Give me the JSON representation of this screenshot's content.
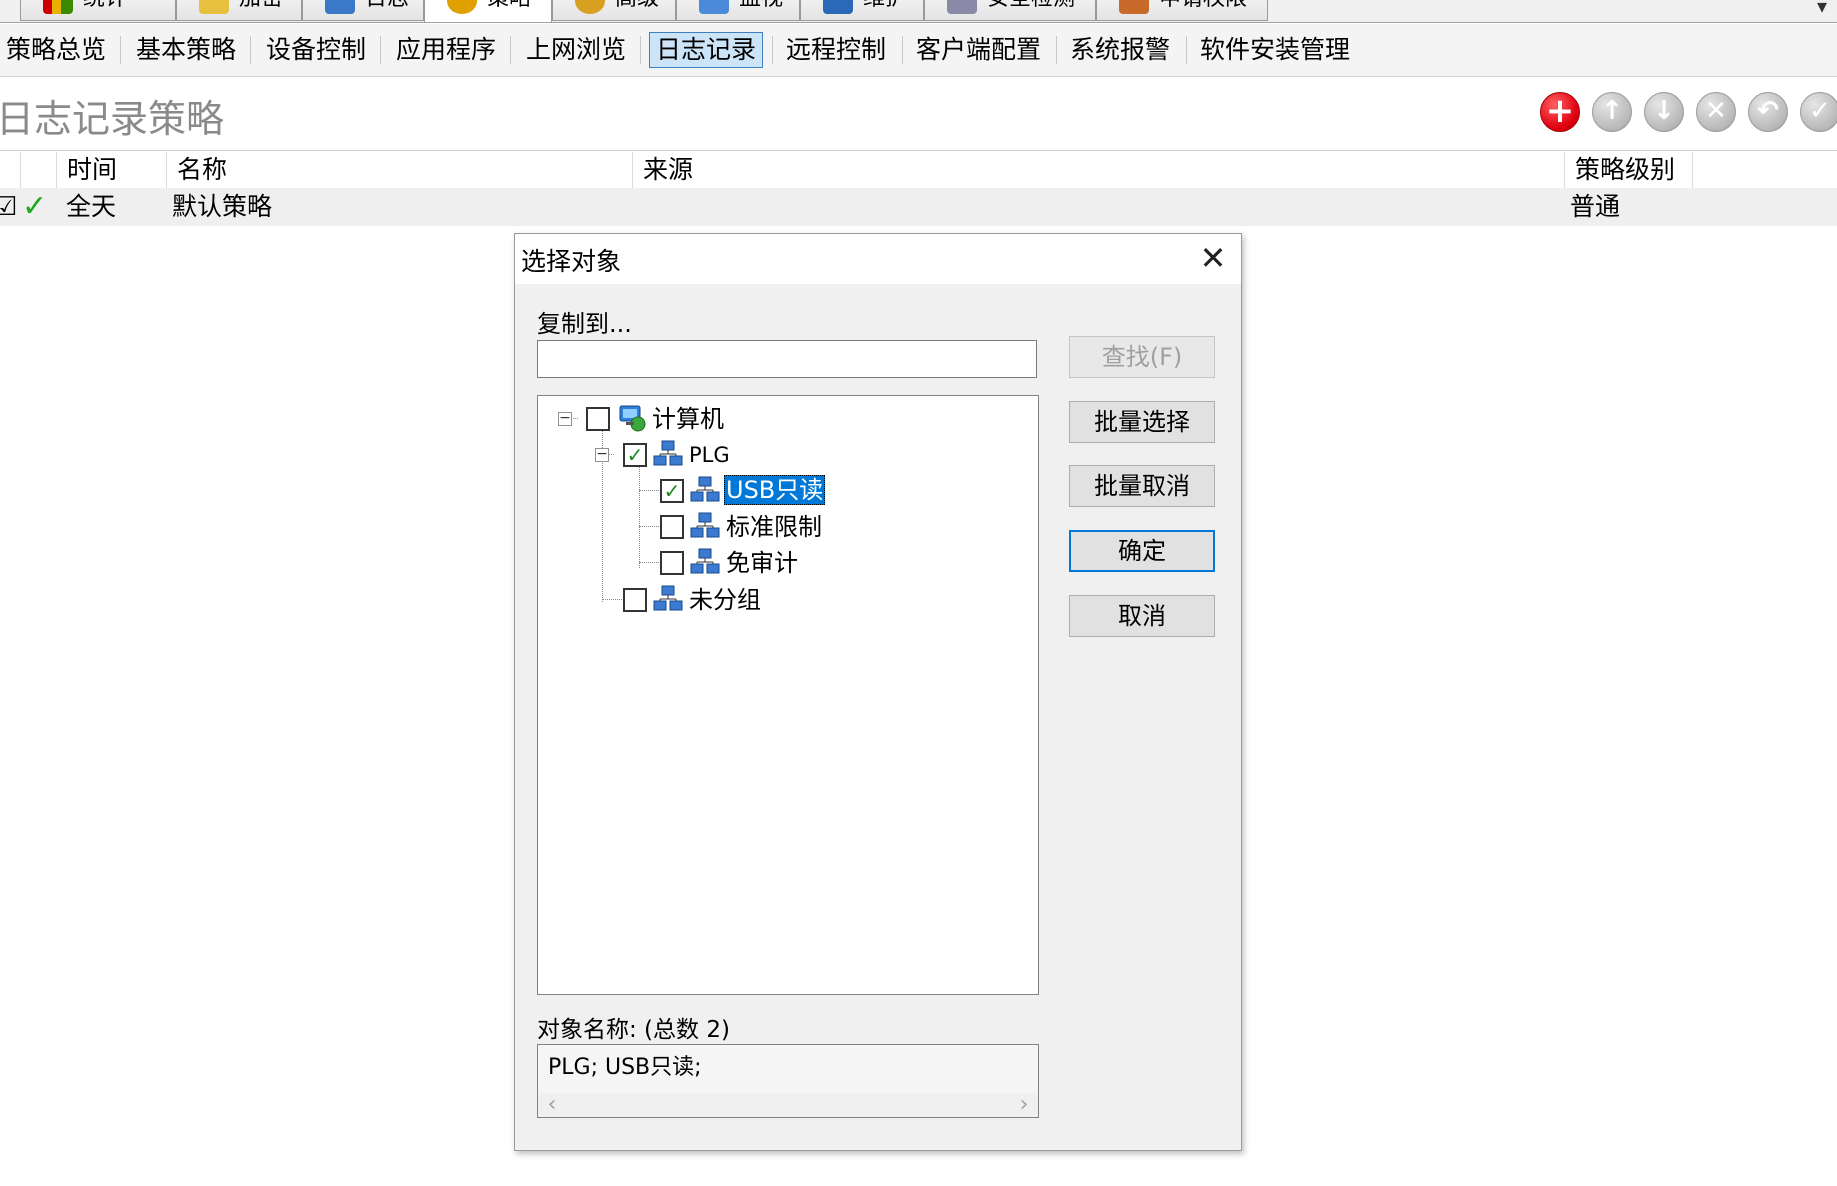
{
  "top_tabs": [
    {
      "label": "统计",
      "icon": "bar-chart-icon",
      "active": false
    },
    {
      "label": "加密",
      "icon": "lock-folder-icon",
      "active": false
    },
    {
      "label": "日志",
      "icon": "book-icon",
      "active": false
    },
    {
      "label": "策略",
      "icon": "gear-icon",
      "active": true
    },
    {
      "label": "高级",
      "icon": "gears-icon",
      "active": false
    },
    {
      "label": "监视",
      "icon": "monitor-icon",
      "active": false
    },
    {
      "label": "维护",
      "icon": "wrench-icon",
      "active": false
    },
    {
      "label": "安全检测",
      "icon": "shield-scan-icon",
      "active": false
    },
    {
      "label": "申请权限",
      "icon": "form-pencil-icon",
      "active": false
    }
  ],
  "subnav": [
    {
      "label": "策略总览"
    },
    {
      "label": "基本策略"
    },
    {
      "label": "设备控制"
    },
    {
      "label": "应用程序"
    },
    {
      "label": "上网浏览"
    },
    {
      "label": "日志记录"
    },
    {
      "label": "远程控制"
    },
    {
      "label": "客户端配置"
    },
    {
      "label": "系统报警"
    },
    {
      "label": "软件安装管理"
    }
  ],
  "subnav_active": "日志记录",
  "page": {
    "title": "日志记录策略"
  },
  "toolbar": {
    "buttons": [
      {
        "name": "add-button",
        "icon": "plus-icon",
        "enabled": true
      },
      {
        "name": "move-up-button",
        "icon": "arrow-up-icon",
        "enabled": false
      },
      {
        "name": "move-down-button",
        "icon": "arrow-down-icon",
        "enabled": false
      },
      {
        "name": "delete-button",
        "icon": "x-icon",
        "enabled": false
      },
      {
        "name": "undo-button",
        "icon": "undo-icon",
        "enabled": false
      },
      {
        "name": "apply-button",
        "icon": "checkmark-icon",
        "enabled": false
      }
    ]
  },
  "table": {
    "columns": [
      "时间",
      "名称",
      "来源",
      "策略级别"
    ],
    "rows": [
      {
        "checked": true,
        "enabled": true,
        "time": "全天",
        "name": "默认策略",
        "source": "",
        "level": "普通"
      }
    ]
  },
  "dialog": {
    "title": "选择对象",
    "copy_to_label": "复制到...",
    "copy_to_value": "",
    "buttons": {
      "find": "查找(F)",
      "batch_select": "批量选择",
      "batch_cancel": "批量取消",
      "ok": "确定",
      "cancel": "取消"
    },
    "tree": {
      "root": {
        "label": "计算机",
        "checked": false,
        "expanded": true
      },
      "groups": [
        {
          "label": "PLG",
          "checked": true,
          "expanded": true,
          "children": [
            {
              "label": "USB只读",
              "checked": true,
              "selected": true
            },
            {
              "label": "标准限制",
              "checked": false,
              "selected": false
            },
            {
              "label": "免审计",
              "checked": false,
              "selected": false
            }
          ]
        },
        {
          "label": "未分组",
          "checked": false,
          "expanded": false
        }
      ]
    },
    "object_names_label": "对象名称: (总数 2)",
    "object_names_value": "PLG; USB只读;"
  },
  "colors": {
    "accent": "#0078d7",
    "check_green": "#1da81d",
    "add_red": "#e00010",
    "title_gray": "#8a8a8a"
  }
}
